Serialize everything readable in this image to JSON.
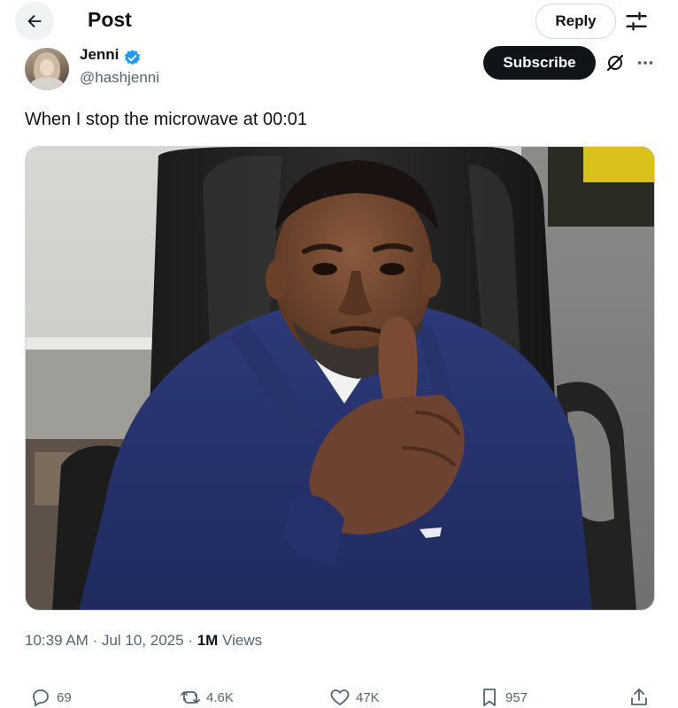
{
  "header": {
    "title": "Post",
    "reply_label": "Reply",
    "back_icon": "arrow-left-icon",
    "filter_icon": "sliders-icon"
  },
  "author": {
    "name": "Jenni",
    "handle": "@hashjenni",
    "verified": true,
    "verified_color": "#1d9bf0",
    "subscribe_label": "Subscribe"
  },
  "post": {
    "text": "When I stop the microwave at 00:01"
  },
  "meta": {
    "time": "10:39 AM",
    "date": "Jul 10, 2025",
    "views_count": "1M",
    "views_label": "Views"
  },
  "actions": {
    "replies": "69",
    "reposts": "4.6K",
    "likes": "47K",
    "bookmarks": "957"
  },
  "colors": {
    "text": "#0f1419",
    "secondary": "#536471",
    "border": "#cfd9de",
    "accent": "#1d9bf0"
  }
}
